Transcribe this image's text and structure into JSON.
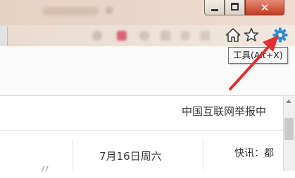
{
  "window": {
    "minimize_glyph": "",
    "close_glyph": "✕"
  },
  "toolbar": {
    "home_icon": "home-icon",
    "favorites_icon": "star-icon",
    "tools_icon": "gear-icon",
    "tools_tooltip": "工具(Alt+X)",
    "accent_color": "#2a8fd6"
  },
  "page": {
    "report_link": "中国互联网举报中",
    "date": "7月16日周六",
    "flash": "快讯：都"
  },
  "annotation": {
    "arrow_color": "#e03030"
  }
}
